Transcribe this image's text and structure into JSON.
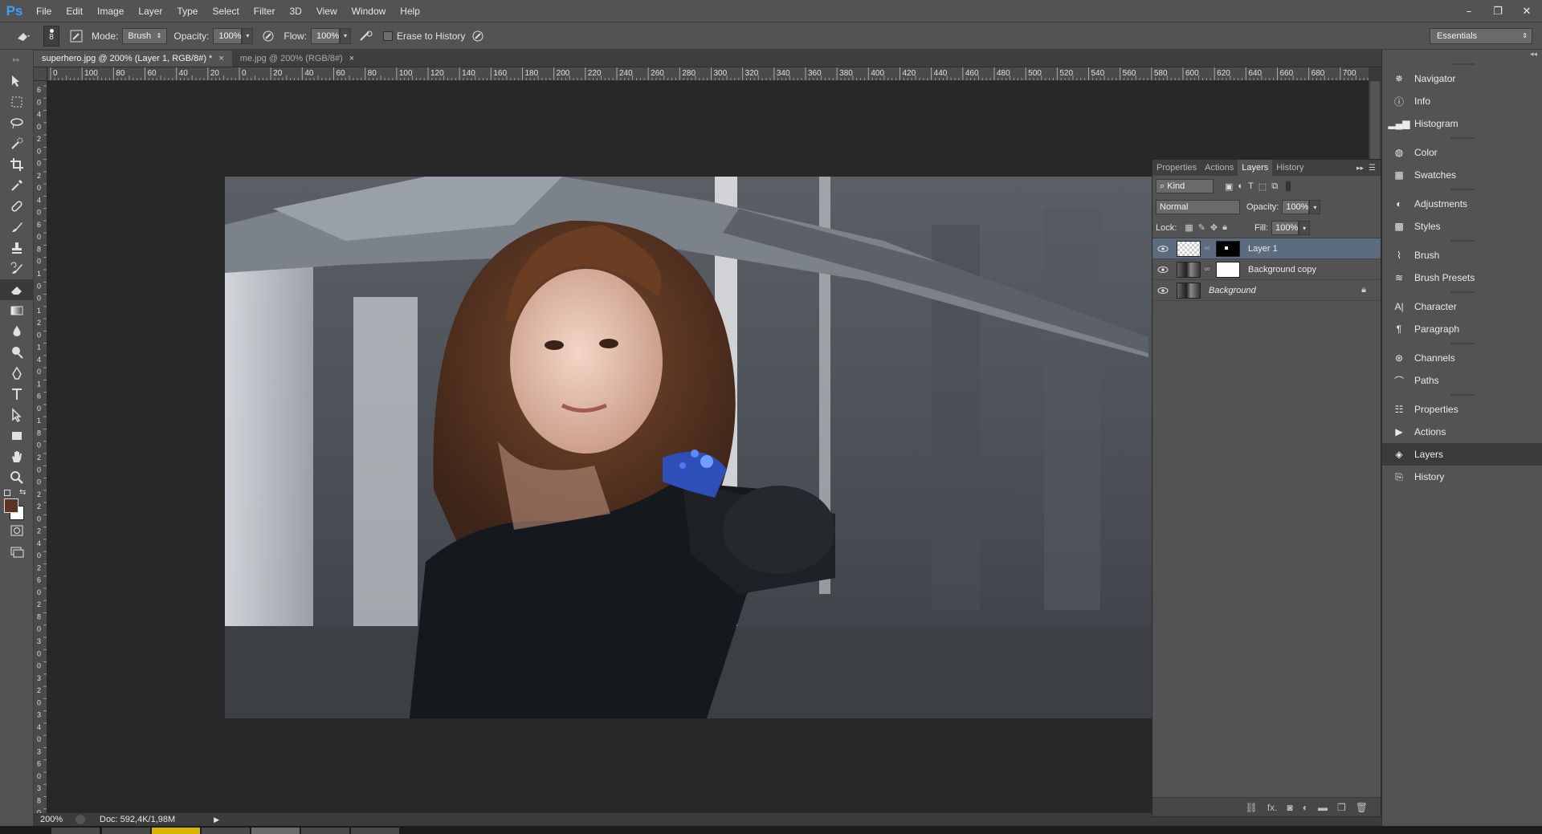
{
  "app": {
    "logo": "Ps"
  },
  "menu": [
    "File",
    "Edit",
    "Image",
    "Layer",
    "Type",
    "Select",
    "Filter",
    "3D",
    "View",
    "Window",
    "Help"
  ],
  "window_controls": {
    "minimize": "–",
    "restore": "❐",
    "close": "✕"
  },
  "options": {
    "brush_size": "8",
    "mode_label": "Mode:",
    "mode_value": "Brush",
    "opacity_label": "Opacity:",
    "opacity_value": "100%",
    "flow_label": "Flow:",
    "flow_value": "100%",
    "erase_history_label": "Erase to History",
    "workspace": "Essentials"
  },
  "doc_tabs": [
    {
      "label": "superhero.jpg @ 200% (Layer 1, RGB/8#) *",
      "close": "×"
    },
    {
      "label": "me.jpg @ 200% (RGB/8#)",
      "close": "×"
    }
  ],
  "ruler_h_labels": [
    "0",
    "100",
    "80",
    "60",
    "40",
    "20",
    "0",
    "20",
    "40",
    "60",
    "80",
    "100",
    "120",
    "140",
    "160",
    "180",
    "200",
    "220",
    "240",
    "260",
    "280",
    "300",
    "320",
    "340",
    "360",
    "380",
    "400",
    "420",
    "440",
    "460",
    "480",
    "500",
    "520",
    "540",
    "560",
    "580",
    "600",
    "620",
    "640",
    "660",
    "680",
    "700"
  ],
  "ruler_v_labels": [
    "6",
    "0",
    "4",
    "0",
    "2",
    "0",
    "0",
    "2",
    "0",
    "4",
    "0",
    "6",
    "0",
    "8",
    "0",
    "1",
    "0",
    "0",
    "1",
    "2",
    "0",
    "1",
    "4",
    "0",
    "1",
    "6",
    "0",
    "1",
    "8",
    "0",
    "2",
    "0",
    "0",
    "2",
    "2",
    "0",
    "2",
    "4",
    "0",
    "2",
    "6",
    "0",
    "2",
    "8",
    "0",
    "3",
    "0",
    "0",
    "3",
    "2",
    "0",
    "3",
    "4",
    "0",
    "3",
    "6",
    "0",
    "3",
    "8",
    "0"
  ],
  "status": {
    "zoom": "200%",
    "doc": "Doc: 592,4K/1,98M"
  },
  "layers_panel": {
    "tabs": [
      "Properties",
      "Actions",
      "Layers",
      "History"
    ],
    "active_tab": "Layers",
    "kind_label": "Kind",
    "blend_mode": "Normal",
    "opacity_label": "Opacity:",
    "opacity_value": "100%",
    "lock_label": "Lock:",
    "fill_label": "Fill:",
    "fill_value": "100%",
    "layers": [
      {
        "name": "Layer 1",
        "selected": true
      },
      {
        "name": "Background copy",
        "selected": false
      },
      {
        "name": "Background",
        "selected": false,
        "locked": true
      }
    ],
    "footer_icons": [
      "link-icon",
      "fx-icon",
      "mask-icon",
      "adjustment-icon",
      "folder-icon",
      "new-layer-icon",
      "trash-icon"
    ],
    "footer_fx": "fx."
  },
  "right_dock": {
    "groups": [
      [
        "Navigator",
        "Info",
        "Histogram"
      ],
      [
        "Color",
        "Swatches"
      ],
      [
        "Adjustments",
        "Styles"
      ],
      [
        "Brush",
        "Brush Presets"
      ],
      [
        "Character",
        "Paragraph"
      ],
      [
        "Channels",
        "Paths"
      ],
      [
        "Properties",
        "Actions",
        "Layers",
        "History"
      ]
    ],
    "active": "Layers"
  },
  "colors": {
    "ui_bg": "#535353",
    "canvas_bg": "#282828",
    "selected_layer": "#5c6b7e",
    "ps_blue": "#3aa0ff",
    "foreground_swatch": "#5a3520",
    "background_swatch": "#ffffff"
  }
}
